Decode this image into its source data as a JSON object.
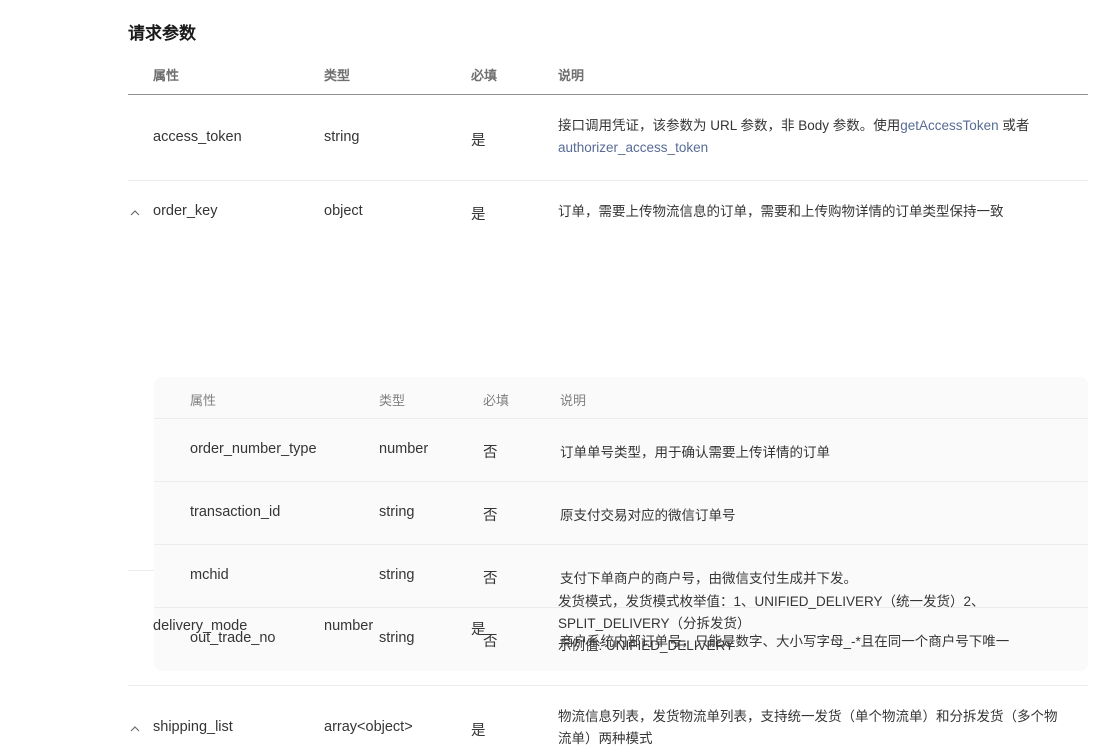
{
  "section_title": "请求参数",
  "columns": {
    "attr": "属性",
    "type": "类型",
    "required": "必填",
    "desc": "说明"
  },
  "rows": [
    {
      "name": "access_token",
      "type": "string",
      "required": "是",
      "desc_prefix": "接口调用凭证，该参数为 URL 参数，非 Body 参数。使用",
      "desc_link1": "getAccessToken",
      "desc_mid": " 或者 ",
      "desc_link2": "authorizer_access_token"
    },
    {
      "name": "order_key",
      "type": "object",
      "required": "是",
      "desc": "订单，需要上传物流信息的订单，需要和上传购物详情的订单类型保持一致"
    },
    {
      "name": "delivery_mode",
      "type": "number",
      "required": "是",
      "desc_line1": "发货模式，发货模式枚举值：1、UNIFIED_DELIVERY（统一发货）2、",
      "desc_line2": "SPLIT_DELIVERY（分拆发货）",
      "desc_line3": "示例值: UNIFIED_DELIVERY"
    },
    {
      "name": "shipping_list",
      "type": "array<object>",
      "required": "是",
      "desc_line1": "物流信息列表，发货物流单列表，支持统一发货（单个物流单）和分拆发货（多个物",
      "desc_line2": "流单）两种模式"
    }
  ],
  "nested": {
    "columns": {
      "attr": "属性",
      "type": "类型",
      "required": "必填",
      "desc": "说明"
    },
    "rows": [
      {
        "name": "order_number_type",
        "type": "number",
        "required": "否",
        "desc": "订单单号类型，用于确认需要上传详情的订单"
      },
      {
        "name": "transaction_id",
        "type": "string",
        "required": "否",
        "desc": "原支付交易对应的微信订单号"
      },
      {
        "name": "mchid",
        "type": "string",
        "required": "否",
        "desc": "支付下单商户的商户号，由微信支付生成并下发。"
      },
      {
        "name": "out_trade_no",
        "type": "string",
        "required": "否",
        "desc": "商户系统内部订单号，只能是数字、大小写字母_-*且在同一个商户号下唯一"
      }
    ]
  },
  "colors": {
    "link": "#576b95",
    "text": "#353535",
    "header_border": "#8f8f8f",
    "row_border": "#ececec",
    "nested_bg": "#fafafa"
  }
}
